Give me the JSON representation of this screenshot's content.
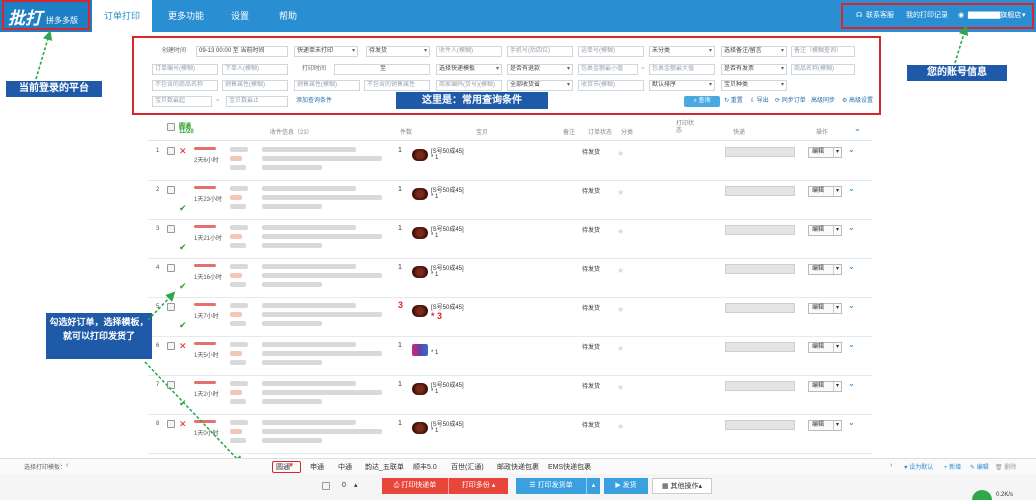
{
  "logo": {
    "main": "批打",
    "sub": "拼多多版"
  },
  "nav": {
    "tabs": [
      "订单打印",
      "更多功能",
      "设置",
      "帮助"
    ]
  },
  "account": {
    "contact": "联系客服",
    "history": "我的打印记录",
    "shop": "▇▇▇▇▇▇旗舰店"
  },
  "annotations": {
    "platform": "当前登录的平台",
    "account": "您的账号信息",
    "query": "这里是：常用查询条件",
    "select": "勾选好订单，选择模板，就可以打印发货了"
  },
  "filters": {
    "create_time_label": "创建时间",
    "create_time_value": "09-13 00:00 至 当前时间",
    "express_status": "快递单未打印",
    "ship_status": "待发货",
    "receiver_name": "收件人(模糊)",
    "phone": "手机号(后四位)",
    "tracking_no": "运单号(模糊)",
    "category": "未分类",
    "memo_select": "选择备注/留言",
    "memo_input": "备注（模糊查询）",
    "order_no": "订单编号(模糊)",
    "buyer": "下单人(模糊)",
    "print_time_label": "打印时间",
    "range_to": "至",
    "express_template": "选择快递模板",
    "is_oos": "是否有退款",
    "amount_min": "包裹金额最小值",
    "amount_max": "包裹金额最大值",
    "has_invoice": "是否有发票",
    "goods_name": "商品名称(模糊)",
    "exclude_name": "不包含的商品名称",
    "attr_fuzzy": "销售属性(模糊)",
    "attr_fuzzy2": "销售属性(模糊)",
    "exclude_attr": "不包含的销售属性",
    "goods_code": "商家编码(货号)(模糊)",
    "province": "全部收货省",
    "city": "收货市(模糊)",
    "sort": "默认排序",
    "goods_type": "宝贝种类",
    "qty_min": "宝贝数最起",
    "qty_max": "宝贝数最止",
    "add_condition": "添加查询条件",
    "query_btn": "查询",
    "reset": "重置",
    "export": "导出",
    "sync": "同步订单",
    "advanced_sync": "高级同步",
    "advanced_settings": "高级设置"
  },
  "table": {
    "select_label": "圆通",
    "select_count": "11/20",
    "headers": [
      "收件信息（23）",
      "件数",
      "宝贝",
      "备注",
      "订单状态",
      "分类",
      "打印状态",
      "快递",
      "操作"
    ],
    "rows": [
      {
        "no": "1",
        "mark": "x",
        "time": "2天6小时",
        "qty": "1",
        "goods": "[S号50成45]",
        "goods_qty": "* 1",
        "status": "待发货",
        "op": "编辑",
        "red": false,
        "purple": false
      },
      {
        "no": "2",
        "mark": "check",
        "time": "1天23小时",
        "qty": "1",
        "goods": "[S号50成45]",
        "goods_qty": "* 1",
        "status": "待发货",
        "op": "编辑",
        "red": false,
        "purple": false
      },
      {
        "no": "3",
        "mark": "check",
        "time": "1天21小时",
        "qty": "1",
        "goods": "[S号50成45]",
        "goods_qty": "* 1",
        "status": "待发货",
        "op": "编辑",
        "red": false,
        "purple": false
      },
      {
        "no": "4",
        "mark": "check",
        "time": "1天16小时",
        "qty": "1",
        "goods": "[S号50成45]",
        "goods_qty": "* 1",
        "status": "待发货",
        "op": "编辑",
        "red": false,
        "purple": false
      },
      {
        "no": "5",
        "mark": "check",
        "time": "1天7小时",
        "qty": "3",
        "goods": "[S号50成45]",
        "goods_qty": "* 3",
        "status": "待发货",
        "op": "编辑",
        "red": true,
        "purple": false
      },
      {
        "no": "6",
        "mark": "x",
        "time": "1天5小时",
        "qty": "1",
        "goods": "",
        "goods_qty": "* 1",
        "status": "待发货",
        "op": "编辑",
        "red": false,
        "purple": true
      },
      {
        "no": "7",
        "mark": "check",
        "time": "1天2小时",
        "qty": "1",
        "goods": "[S号50成45]",
        "goods_qty": "* 1",
        "status": "待发货",
        "op": "编辑",
        "red": false,
        "purple": false
      },
      {
        "no": "8",
        "mark": "x",
        "time": "1天0小时",
        "qty": "1",
        "goods": "[S号50成45]",
        "goods_qty": "* 1",
        "status": "待发货",
        "op": "编辑",
        "red": false,
        "purple": false
      }
    ]
  },
  "template_bar": {
    "label": "选择打印模板：",
    "tabs": [
      "圆通",
      "申通",
      "中通",
      "韵达_五联单",
      "顺丰5.0",
      "百世(汇通)",
      "邮政快递包裹",
      "EMS快递包裹"
    ],
    "set_default": "设为默认",
    "add": "新增",
    "edit": "编辑",
    "delete": "删除"
  },
  "actions": {
    "page_count": "0",
    "print_express": "打印快递单",
    "print_multi": "打印多份",
    "print_ship": "打印发货单",
    "ship": "发货",
    "more": "其他操作"
  },
  "status": {
    "speed": "0.2K/s"
  },
  "colors": {
    "brand": "#2a8ed3",
    "annotation": "#1f5aa8",
    "highlight": "#d9262c",
    "action_red": "#e8463a",
    "action_blue": "#3aa0e0"
  }
}
